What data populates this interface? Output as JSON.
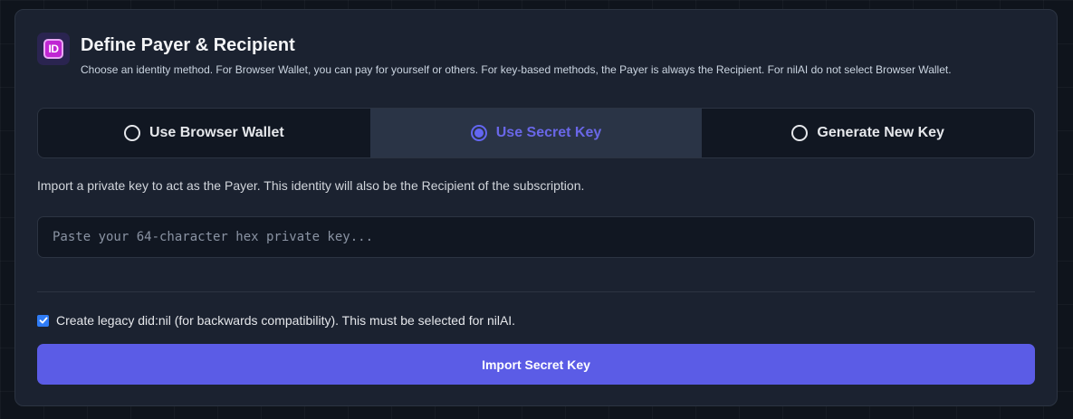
{
  "header": {
    "badge_text": "ID",
    "title": "Define Payer & Recipient",
    "description": "Choose an identity method. For Browser Wallet, you can pay for yourself or others. For key-based methods, the Payer is always the Recipient. For nilAI do not select Browser Wallet."
  },
  "tabs": [
    {
      "label": "Use Browser Wallet",
      "selected": false
    },
    {
      "label": "Use Secret Key",
      "selected": true
    },
    {
      "label": "Generate New Key",
      "selected": false
    }
  ],
  "secret_key": {
    "info": "Import a private key to act as the Payer. This identity will also be the Recipient of the subscription.",
    "placeholder": "Paste your 64-character hex private key...",
    "value": ""
  },
  "legacy": {
    "checked": true,
    "label": "Create legacy did:nil (for backwards compatibility). This must be selected for nilAI."
  },
  "import_button": {
    "label": "Import Secret Key"
  },
  "colors": {
    "accent": "#5b5ce6",
    "active_tab_text": "#6a67e8",
    "checkbox": "#2f7cf6",
    "badge": "#c026d3"
  }
}
